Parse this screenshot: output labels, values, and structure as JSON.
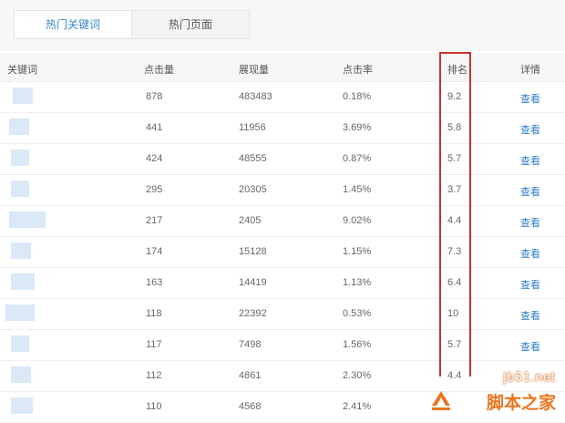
{
  "tabs": [
    {
      "label": "热门关键词",
      "active": true
    },
    {
      "label": "热门页面",
      "active": false
    }
  ],
  "columns": {
    "keyword": "关键词",
    "clicks": "点击量",
    "impressions": "展现量",
    "ctr": "点击率",
    "rank": "排名",
    "details": "详情"
  },
  "rows": [
    {
      "clicks": "878",
      "impressions": "483483",
      "ctr": "0.18%",
      "rank": "9.2",
      "details": "查看"
    },
    {
      "clicks": "441",
      "impressions": "11956",
      "ctr": "3.69%",
      "rank": "5.8",
      "details": "查看"
    },
    {
      "clicks": "424",
      "impressions": "48555",
      "ctr": "0.87%",
      "rank": "5.7",
      "details": "查看"
    },
    {
      "clicks": "295",
      "impressions": "20305",
      "ctr": "1.45%",
      "rank": "3.7",
      "details": "查看"
    },
    {
      "clicks": "217",
      "impressions": "2405",
      "ctr": "9.02%",
      "rank": "4.4",
      "details": "查看"
    },
    {
      "clicks": "174",
      "impressions": "15128",
      "ctr": "1.15%",
      "rank": "7.3",
      "details": "查看"
    },
    {
      "clicks": "163",
      "impressions": "14419",
      "ctr": "1.13%",
      "rank": "6.4",
      "details": "查看"
    },
    {
      "clicks": "118",
      "impressions": "22392",
      "ctr": "0.53%",
      "rank": "10",
      "details": "查看"
    },
    {
      "clicks": "117",
      "impressions": "7498",
      "ctr": "1.56%",
      "rank": "5.7",
      "details": "查看"
    },
    {
      "clicks": "112",
      "impressions": "4861",
      "ctr": "2.30%",
      "rank": "4.4",
      "details": ""
    },
    {
      "clicks": "110",
      "impressions": "4568",
      "ctr": "2.41%",
      "rank": "",
      "details": ""
    }
  ],
  "watermark": {
    "url": "jb51.net",
    "name": "脚本之家"
  },
  "colors": {
    "link": "#2d7ec8",
    "highlight_box": "#c8332f",
    "active_tab_text": "#3a87c8",
    "watermark": "#e9761f"
  }
}
